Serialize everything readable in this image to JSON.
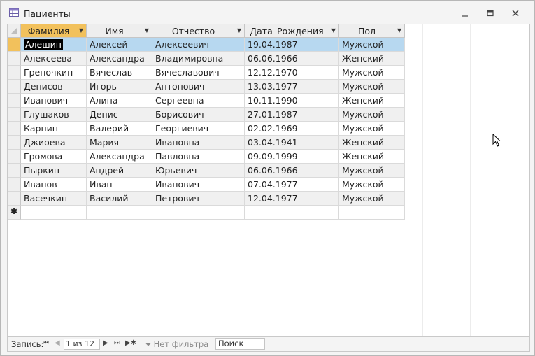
{
  "window": {
    "title": "Пациенты"
  },
  "table": {
    "columns": [
      {
        "label": "Фамилия"
      },
      {
        "label": "Имя"
      },
      {
        "label": "Отчество"
      },
      {
        "label": "Дата_Рождения"
      },
      {
        "label": "Пол"
      }
    ],
    "rows": [
      [
        "Алешин",
        "Алексей",
        "Алексеевич",
        "19.04.1987",
        "Мужской"
      ],
      [
        "Алексеева",
        "Александра",
        "Владимировна",
        "06.06.1966",
        "Женский"
      ],
      [
        "Греночкин",
        "Вячеслав",
        "Вячеславович",
        "12.12.1970",
        "Мужской"
      ],
      [
        "Денисов",
        "Игорь",
        "Антонович",
        "13.03.1977",
        "Мужской"
      ],
      [
        "Иванович",
        "Алина",
        "Сергеевна",
        "10.11.1990",
        "Женский"
      ],
      [
        "Глушаков",
        "Денис",
        "Борисович",
        "27.01.1987",
        "Мужской"
      ],
      [
        "Карпин",
        "Валерий",
        "Георгиевич",
        "02.02.1969",
        "Мужской"
      ],
      [
        "Джиоева",
        "Мария",
        "Ивановна",
        "03.04.1941",
        "Женский"
      ],
      [
        "Громова",
        "Александра",
        "Павловна",
        "09.09.1999",
        "Женский"
      ],
      [
        "Пыркин",
        "Андрей",
        "Юрьевич",
        "06.06.1966",
        "Мужской"
      ],
      [
        "Иванов",
        "Иван",
        "Иванович",
        "07.04.1977",
        "Мужской"
      ],
      [
        "Васечкин",
        "Василий",
        "Петрович",
        "12.04.1977",
        "Мужской"
      ]
    ],
    "new_row_marker": "✱"
  },
  "navigation": {
    "record_label": "Запись:",
    "record_value": "1 из 12",
    "filter_label": "Нет фильтра",
    "search_placeholder": "Поиск"
  }
}
